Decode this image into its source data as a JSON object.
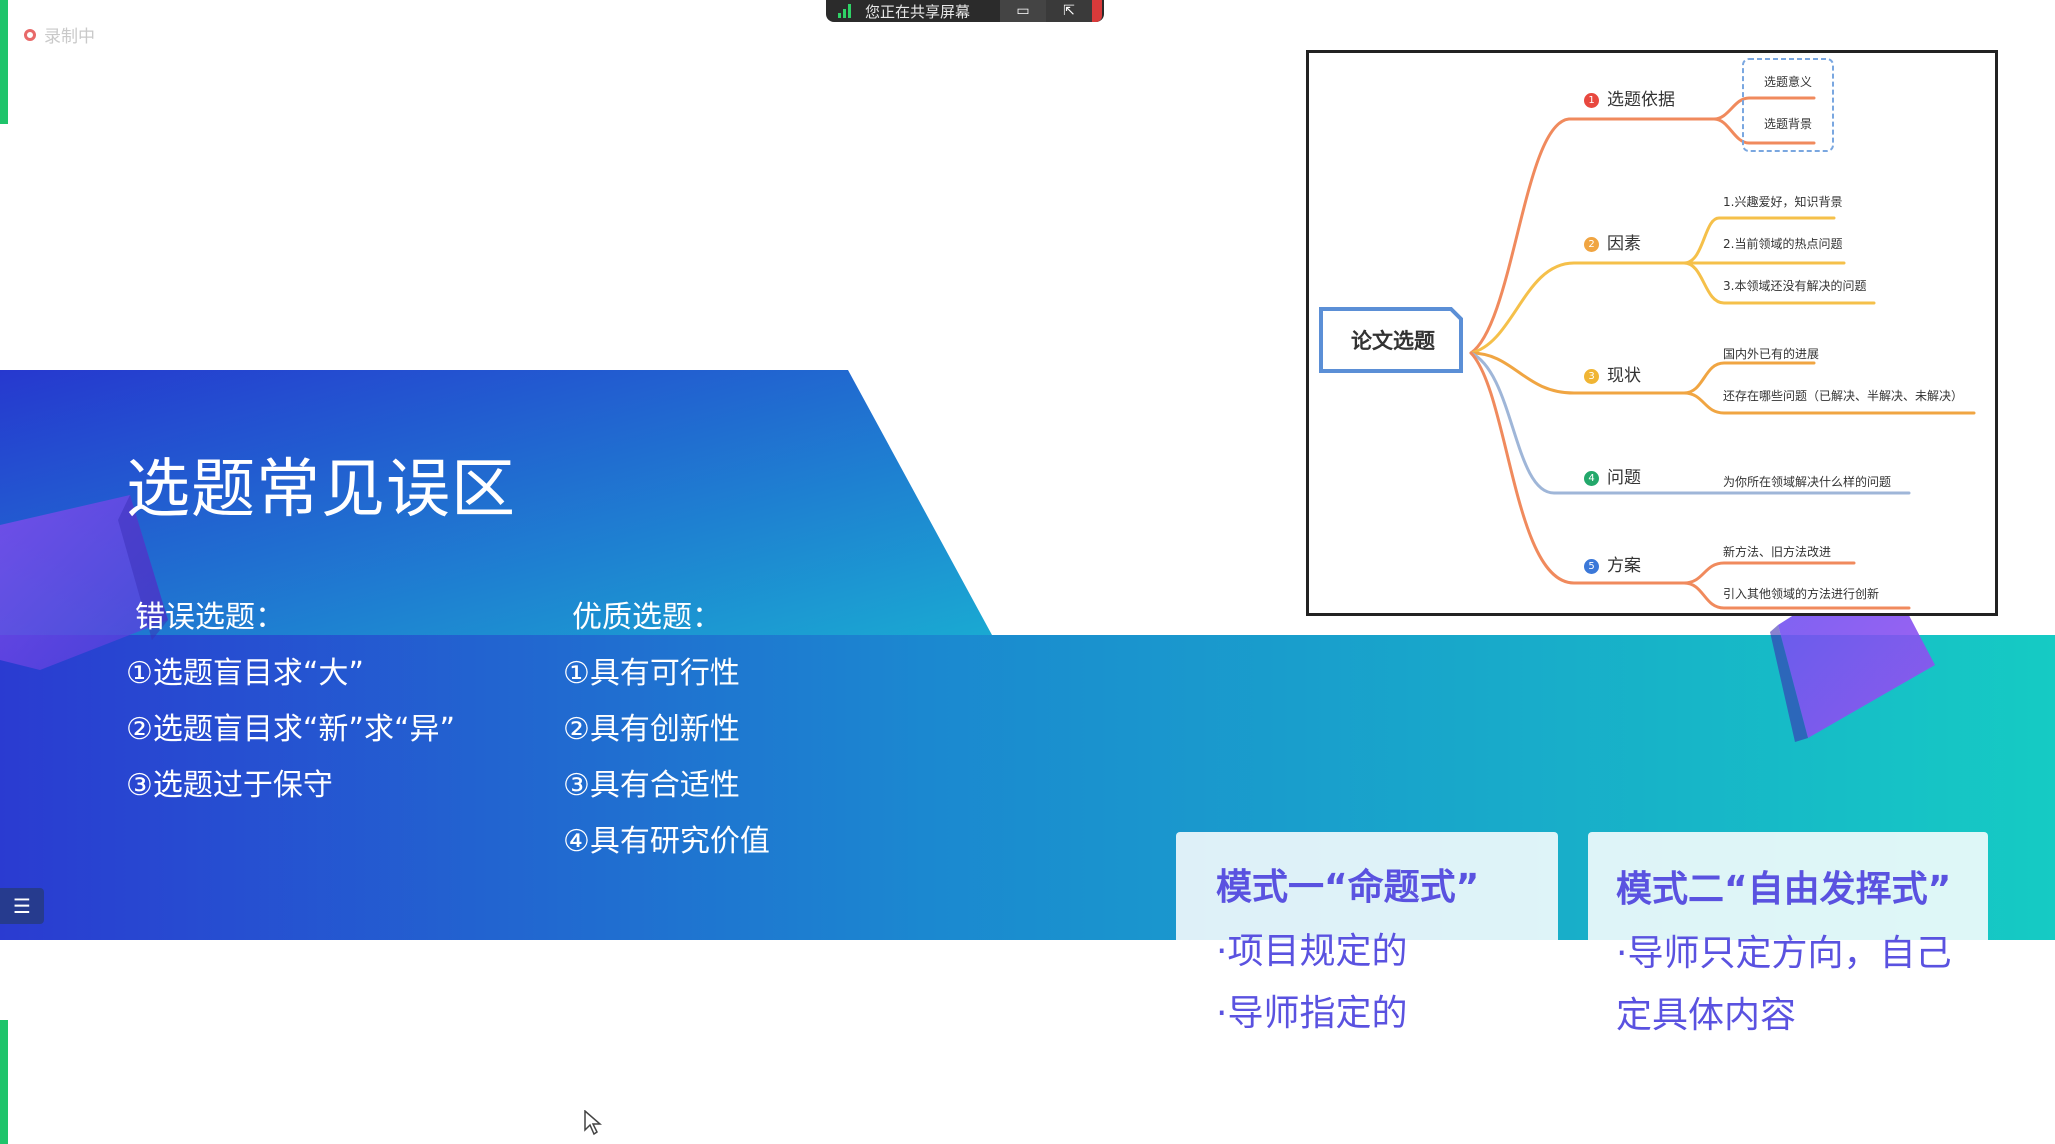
{
  "recording": {
    "label": "录制中"
  },
  "share_bar": {
    "status": "您正在共享屏幕"
  },
  "slide": {
    "title": "选题常见误区",
    "wrong": {
      "heading": "错误选题：",
      "items": [
        "①选题盲目求“大”",
        "②选题盲目求“新”求“异”",
        "③选题过于保守"
      ]
    },
    "good": {
      "heading": "优质选题：",
      "items": [
        "①具有可行性",
        "②具有创新性",
        "③具有合适性",
        "④具有研究价值"
      ]
    },
    "mindmap": {
      "root": "论文选题",
      "branches": [
        {
          "num": "1",
          "label": "选题依据",
          "color": "#e8483f",
          "leaves": [
            "选题意义",
            "选题背景"
          ]
        },
        {
          "num": "2",
          "label": "因素",
          "color": "#f0a542",
          "leaves": [
            "1.兴趣爱好，知识背景",
            "2.当前领域的热点问题",
            "3.本领域还没有解决的问题"
          ]
        },
        {
          "num": "3",
          "label": "现状",
          "color": "#f0b534",
          "leaves": [
            "国内外已有的进展",
            "还存在哪些问题（已解决、半解决、未解决）"
          ]
        },
        {
          "num": "4",
          "label": "问题",
          "color": "#23a86b",
          "leaves": [
            "为你所在领域解决什么样的问题"
          ]
        },
        {
          "num": "5",
          "label": "方案",
          "color": "#3b78d8",
          "leaves": [
            "新方法、旧方法改进",
            "引入其他领域的方法进行创新"
          ]
        }
      ]
    },
    "patterns": [
      {
        "title": "模式一“命题式”",
        "lines": [
          "·项目规定的",
          "·导师指定的"
        ]
      },
      {
        "title": "模式二“自由发挥式”",
        "lines": [
          "·导师只定方向，自己",
          "定具体内容"
        ]
      }
    ]
  },
  "colors": {
    "accent": "#5a52e0",
    "banner_left": "#2a3fd0",
    "banner_right": "#1ac7c3"
  }
}
